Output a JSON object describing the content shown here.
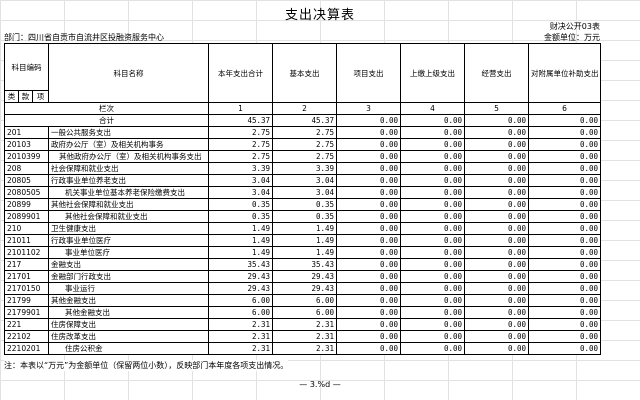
{
  "title": "支出决算表",
  "form_no": "财决公开03表",
  "dept": "部门：四川省自贡市自流井区投融资服务中心",
  "unit": "金额单位：万元",
  "headers": {
    "code": "科目编码",
    "name": "科目名称",
    "cols": [
      "本年支出合计",
      "基本支出",
      "项目支出",
      "上缴上级支出",
      "经营支出",
      "对附属单位补助支出"
    ],
    "lei": "类",
    "kuan": "款",
    "xiang": "项",
    "lanci": "栏次",
    "col_nums": [
      "1",
      "2",
      "3",
      "4",
      "5",
      "6"
    ]
  },
  "total": {
    "label": "合计",
    "values": [
      "45.37",
      "45.37",
      "0.00",
      "0.00",
      "0.00",
      "0.00"
    ]
  },
  "rows": [
    {
      "code": "201",
      "name": "一般公共服务支出",
      "level": 0,
      "values": [
        "2.75",
        "2.75",
        "0.00",
        "0.00",
        "0.00",
        "0.00"
      ]
    },
    {
      "code": "20103",
      "name": "政府办公厅（室）及相关机构事务",
      "level": 0,
      "values": [
        "2.75",
        "2.75",
        "0.00",
        "0.00",
        "0.00",
        "0.00"
      ]
    },
    {
      "code": "2010399",
      "name": "其他政府办公厅（室）及相关机构事务支出",
      "level": 1,
      "values": [
        "2.75",
        "2.75",
        "0.00",
        "0.00",
        "0.00",
        "0.00"
      ]
    },
    {
      "code": "208",
      "name": "社会保障和就业支出",
      "level": 0,
      "values": [
        "3.39",
        "3.39",
        "0.00",
        "0.00",
        "0.00",
        "0.00"
      ]
    },
    {
      "code": "20805",
      "name": "行政事业单位养老支出",
      "level": 0,
      "values": [
        "3.04",
        "3.04",
        "0.00",
        "0.00",
        "0.00",
        "0.00"
      ]
    },
    {
      "code": "2080505",
      "name": "机关事业单位基本养老保险缴费支出",
      "level": 2,
      "values": [
        "3.04",
        "3.04",
        "0.00",
        "0.00",
        "0.00",
        "0.00"
      ]
    },
    {
      "code": "20899",
      "name": "其他社会保障和就业支出",
      "level": 0,
      "values": [
        "0.35",
        "0.35",
        "0.00",
        "0.00",
        "0.00",
        "0.00"
      ]
    },
    {
      "code": "2089901",
      "name": "其他社会保障和就业支出",
      "level": 2,
      "values": [
        "0.35",
        "0.35",
        "0.00",
        "0.00",
        "0.00",
        "0.00"
      ]
    },
    {
      "code": "210",
      "name": "卫生健康支出",
      "level": 0,
      "values": [
        "1.49",
        "1.49",
        "0.00",
        "0.00",
        "0.00",
        "0.00"
      ]
    },
    {
      "code": "21011",
      "name": "行政事业单位医疗",
      "level": 0,
      "values": [
        "1.49",
        "1.49",
        "0.00",
        "0.00",
        "0.00",
        "0.00"
      ]
    },
    {
      "code": "2101102",
      "name": "事业单位医疗",
      "level": 2,
      "values": [
        "1.49",
        "1.49",
        "0.00",
        "0.00",
        "0.00",
        "0.00"
      ]
    },
    {
      "code": "217",
      "name": "金融支出",
      "level": 0,
      "values": [
        "35.43",
        "35.43",
        "0.00",
        "0.00",
        "0.00",
        "0.00"
      ]
    },
    {
      "code": "21701",
      "name": "金融部门行政支出",
      "level": 0,
      "values": [
        "29.43",
        "29.43",
        "0.00",
        "0.00",
        "0.00",
        "0.00"
      ]
    },
    {
      "code": "2170150",
      "name": "事业运行",
      "level": 2,
      "values": [
        "29.43",
        "29.43",
        "0.00",
        "0.00",
        "0.00",
        "0.00"
      ]
    },
    {
      "code": "21799",
      "name": "其他金融支出",
      "level": 0,
      "values": [
        "6.00",
        "6.00",
        "0.00",
        "0.00",
        "0.00",
        "0.00"
      ]
    },
    {
      "code": "2179901",
      "name": "其他金融支出",
      "level": 2,
      "values": [
        "6.00",
        "6.00",
        "0.00",
        "0.00",
        "0.00",
        "0.00"
      ]
    },
    {
      "code": "221",
      "name": "住房保障支出",
      "level": 0,
      "values": [
        "2.31",
        "2.31",
        "0.00",
        "0.00",
        "0.00",
        "0.00"
      ]
    },
    {
      "code": "22102",
      "name": "住房改革支出",
      "level": 0,
      "values": [
        "2.31",
        "2.31",
        "0.00",
        "0.00",
        "0.00",
        "0.00"
      ]
    },
    {
      "code": "2210201",
      "name": "住房公积金",
      "level": 2,
      "values": [
        "2.31",
        "2.31",
        "0.00",
        "0.00",
        "0.00",
        "0.00"
      ]
    }
  ],
  "note": "注：本表以“万元”为金额单位（保留两位小数），反映部门本年度各项支出情况。",
  "pager": "— 3.%d —"
}
